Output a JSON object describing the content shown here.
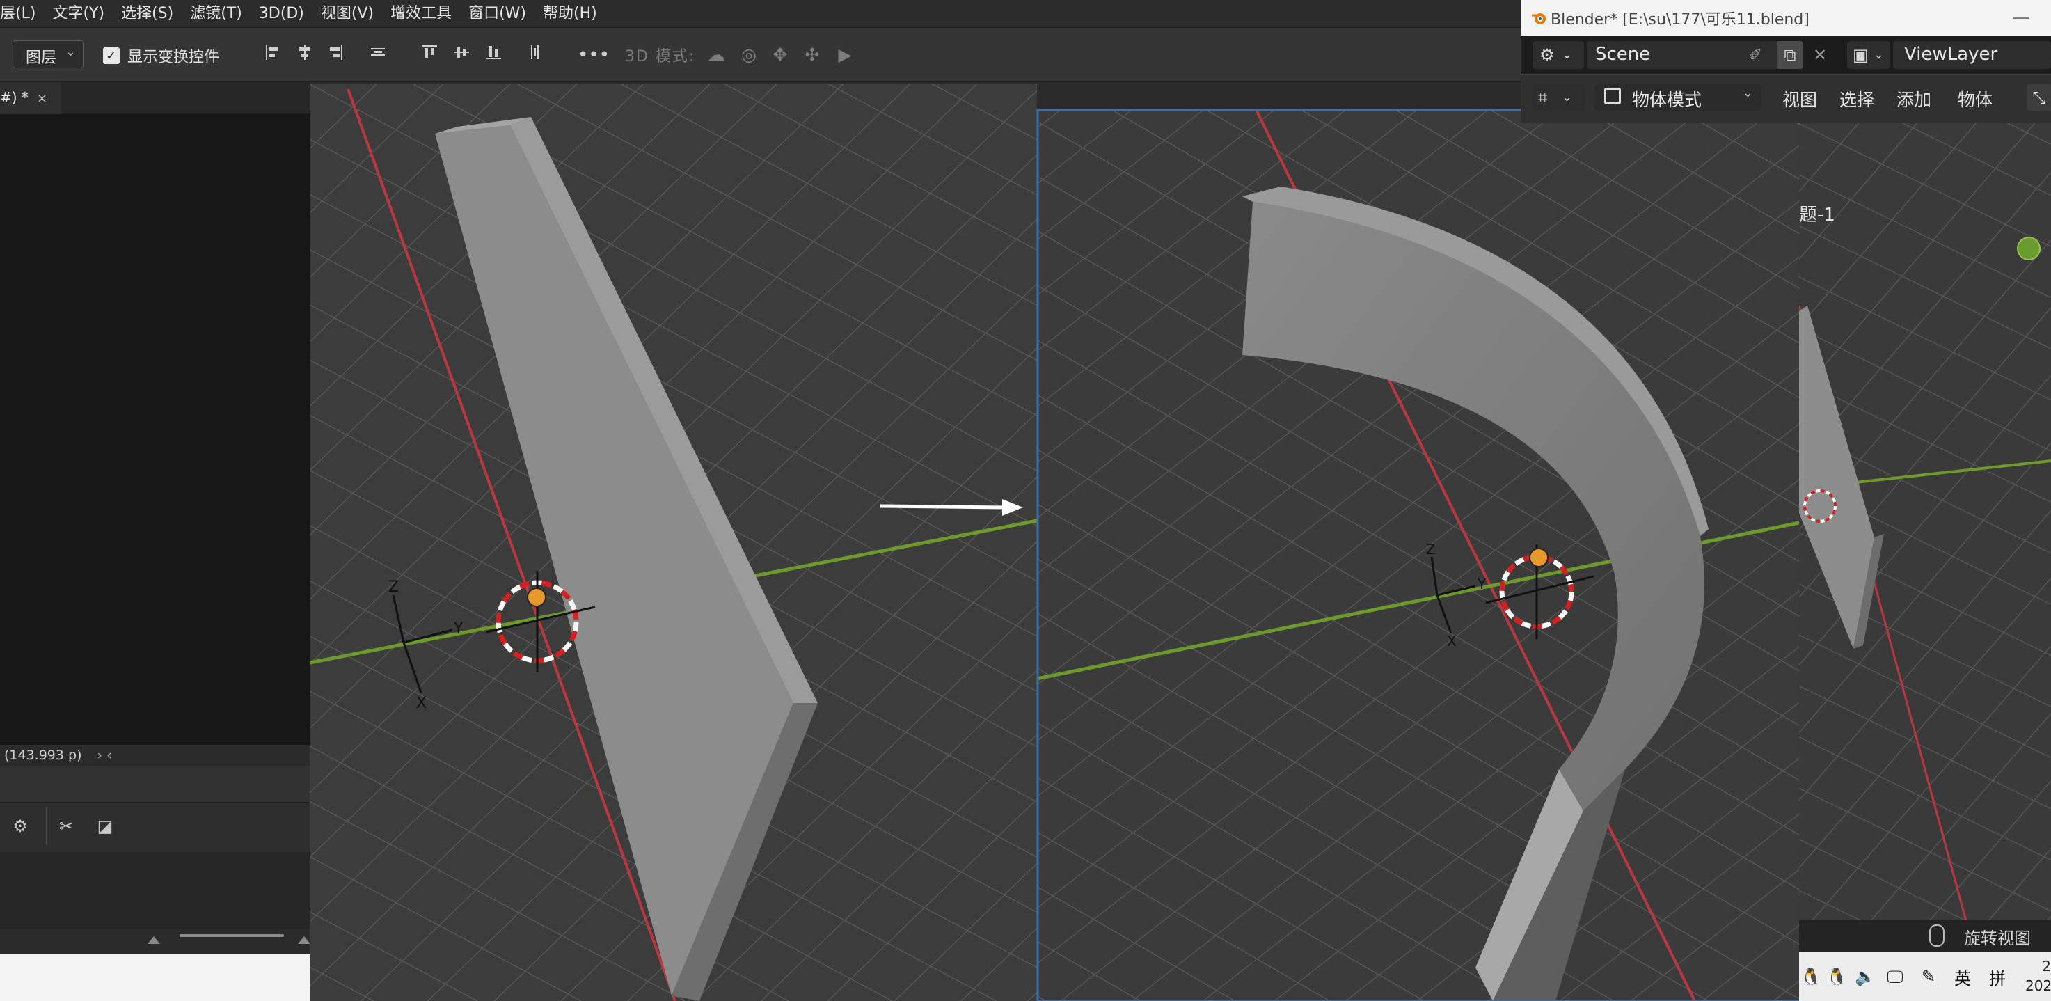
{
  "photoshop": {
    "menu": [
      "层(L)",
      "文字(Y)",
      "选择(S)",
      "滤镜(T)",
      "3D(D)",
      "视图(V)",
      "增效工具",
      "窗口(W)",
      "帮助(H)"
    ],
    "options": {
      "layer_select": "图层",
      "show_transform_label": "显示变换控件",
      "show_transform_checked": true,
      "mode_3d_label": "3D 模式:"
    },
    "document_tab": {
      "title": "#) *",
      "close": "×"
    },
    "status_text": "(143.993 p)",
    "status_arrows": "›  ‹"
  },
  "canvas": {
    "left_object": "straight-bar",
    "right_object": "curved-arc",
    "arrow": "right",
    "axis_labels": [
      "Z",
      "Y",
      "X"
    ],
    "colors": {
      "x_axis": "#b8383f",
      "y_axis": "#6d9a2b",
      "cursor_red": "#d42020",
      "origin": "#e79a2a"
    }
  },
  "blender": {
    "title": "Blender* [E:\\su\\177\\可乐11.blend]",
    "minimize": "—",
    "scene": "Scene",
    "view_layer": "ViewLayer",
    "mode": "物体模式",
    "menus": [
      "视图",
      "选择",
      "添加",
      "物体"
    ],
    "viewport_label": "题-1",
    "status_hint": "旋转视图"
  },
  "taskbar": {
    "ime_lang": "英",
    "ime_mode": "拼",
    "clock_line1": "2",
    "clock_line2": "202"
  }
}
